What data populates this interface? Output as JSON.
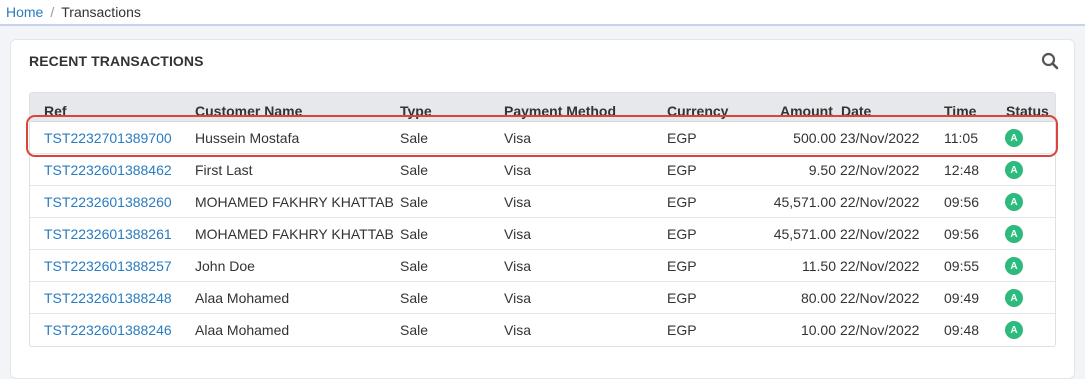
{
  "breadcrumb": {
    "home": "Home",
    "separator": "/",
    "current": "Transactions"
  },
  "card": {
    "title": "RECENT TRANSACTIONS",
    "search_icon": "search-icon"
  },
  "table": {
    "headers": {
      "ref": "Ref",
      "customer": "Customer Name",
      "type": "Type",
      "method": "Payment Method",
      "currency": "Currency",
      "amount": "Amount",
      "date": "Date",
      "time": "Time",
      "status": "Status"
    },
    "rows": [
      {
        "ref": "TST2232701389700",
        "customer": "Hussein Mostafa",
        "type": "Sale",
        "method": "Visa",
        "currency": "EGP",
        "amount": "500.00",
        "date": "23/Nov/2022",
        "time": "11:05",
        "status": "A"
      },
      {
        "ref": "TST2232601388462",
        "customer": "First Last",
        "type": "Sale",
        "method": "Visa",
        "currency": "EGP",
        "amount": "9.50",
        "date": "22/Nov/2022",
        "time": "12:48",
        "status": "A"
      },
      {
        "ref": "TST2232601388260",
        "customer": "MOHAMED FAKHRY KHATTAB",
        "type": "Sale",
        "method": "Visa",
        "currency": "EGP",
        "amount": "45,571.00",
        "date": "22/Nov/2022",
        "time": "09:56",
        "status": "A"
      },
      {
        "ref": "TST2232601388261",
        "customer": "MOHAMED FAKHRY KHATTAB",
        "type": "Sale",
        "method": "Visa",
        "currency": "EGP",
        "amount": "45,571.00",
        "date": "22/Nov/2022",
        "time": "09:56",
        "status": "A"
      },
      {
        "ref": "TST2232601388257",
        "customer": "John Doe",
        "type": "Sale",
        "method": "Visa",
        "currency": "EGP",
        "amount": "11.50",
        "date": "22/Nov/2022",
        "time": "09:55",
        "status": "A"
      },
      {
        "ref": "TST2232601388248",
        "customer": "Alaa Mohamed",
        "type": "Sale",
        "method": "Visa",
        "currency": "EGP",
        "amount": "80.00",
        "date": "22/Nov/2022",
        "time": "09:49",
        "status": "A"
      },
      {
        "ref": "TST2232601388246",
        "customer": "Alaa Mohamed",
        "type": "Sale",
        "method": "Visa",
        "currency": "EGP",
        "amount": "10.00",
        "date": "22/Nov/2022",
        "time": "09:48",
        "status": "A"
      }
    ]
  },
  "colors": {
    "link": "#2a7bbf",
    "status_approved": "#2dbb7d",
    "highlight": "#d9453a"
  }
}
